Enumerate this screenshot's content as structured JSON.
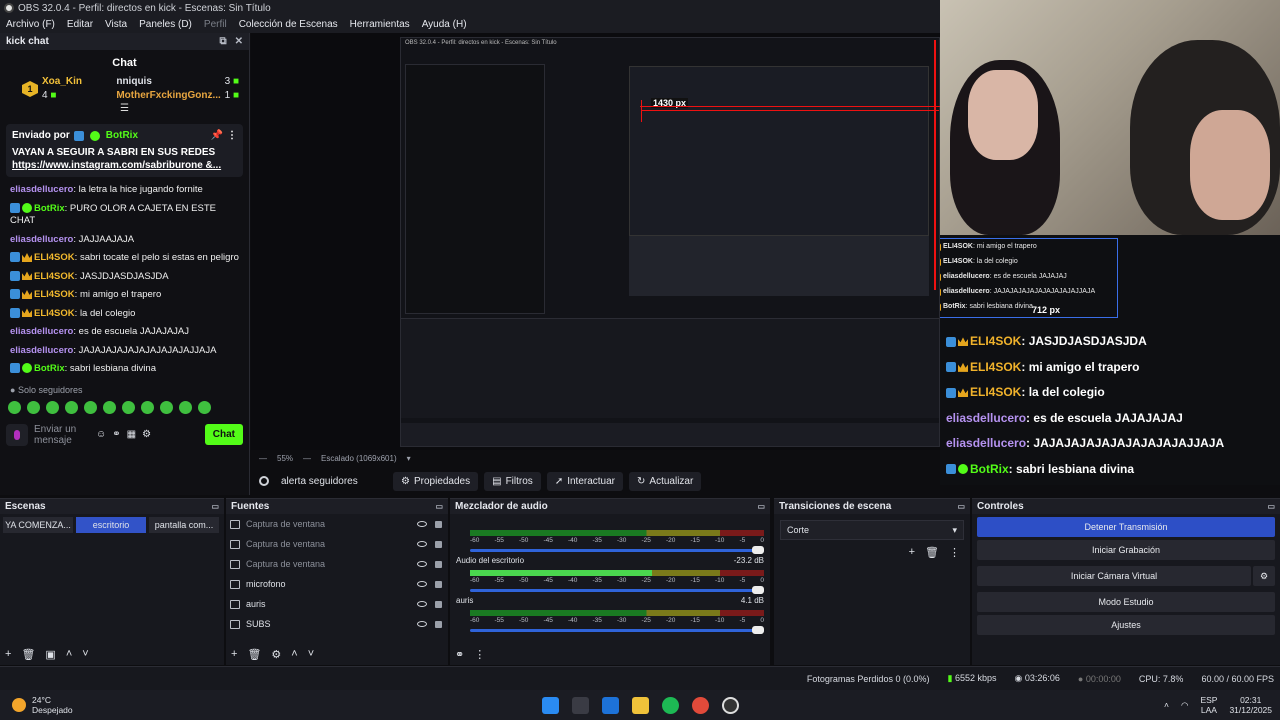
{
  "window": {
    "title": "OBS 32.0.4 - Perfil: directos en kick - Escenas: Sin Título"
  },
  "menu": [
    {
      "label": "Archivo (F)"
    },
    {
      "label": "Editar"
    },
    {
      "label": "Vista"
    },
    {
      "label": "Paneles (D)"
    },
    {
      "label": "Perfil"
    },
    {
      "label": "Colección de Escenas"
    },
    {
      "label": "Herramientas"
    },
    {
      "label": "Ayuda (H)"
    }
  ],
  "chat_dock": {
    "dock_title": "kick chat",
    "title": "Chat",
    "top": [
      {
        "rank": "1",
        "name": "Xoa_Kin",
        "count": "4"
      },
      {
        "name": "nniquis",
        "count": "3"
      },
      {
        "name": "MotherFxckingGonz...",
        "count": "1"
      }
    ],
    "pinned": {
      "header": "Enviado por",
      "user": "BotRix",
      "message": "VAYAN A SEGUIR A SABRI EN SUS REDES",
      "link": "https://www.instagram.com/sabriburone &..."
    },
    "messages": [
      {
        "user": "eliasdellucero",
        "text": "la letra la hice jugando fornite",
        "style": "blue",
        "badges": ""
      },
      {
        "user": "BotRix",
        "text": "PURO OLOR A CAJETA EN ESTE CHAT",
        "style": "green",
        "badges": "bot"
      },
      {
        "user": "eliasdellucero",
        "text": "JAJJAAJAJA",
        "style": "blue",
        "badges": ""
      },
      {
        "user": "ELI4SOK",
        "text": "sabri tocate el pelo si estas en peligro",
        "style": "gold",
        "badges": "crown"
      },
      {
        "user": "ELI4SOK",
        "text": "JASJDJASDJASJDA",
        "style": "gold",
        "badges": "crown"
      },
      {
        "user": "ELI4SOK",
        "text": "mi amigo el trapero",
        "style": "gold",
        "badges": "crown"
      },
      {
        "user": "ELI4SOK",
        "text": "la del colegio",
        "style": "gold",
        "badges": "crown"
      },
      {
        "user": "eliasdellucero",
        "text": "es de escuela JAJAJAJAJ",
        "style": "blue",
        "badges": ""
      },
      {
        "user": "eliasdellucero",
        "text": "JAJAJAJAJAJAJAJAJAJAJJAJA",
        "style": "blue",
        "badges": ""
      },
      {
        "user": "BotRix",
        "text": "sabri lesbiana divina",
        "style": "green",
        "badges": "bot"
      }
    ],
    "followers_only": "Solo seguidores",
    "input_placeholder": "Enviar un mensaje",
    "send_label": "Chat"
  },
  "preview": {
    "zoom": "55%",
    "scale": "Escalado (1069x601)",
    "width_label_1": "1430 px",
    "width_label_2": "712 px",
    "overlay_big": [
      {
        "user": "ELI4SOK",
        "text": "JASJDJASDJASJDA",
        "style": "gold"
      },
      {
        "user": "ELI4SOK",
        "text": "mi amigo el trapero",
        "style": "gold"
      },
      {
        "user": "ELI4SOK",
        "text": "la del colegio",
        "style": "gold"
      },
      {
        "user": "eliasdellucero",
        "text": "es de escuela JAJAJAJAJ",
        "style": "blue"
      },
      {
        "user": "eliasdellucero",
        "text": "JAJAJAJAJAJAJAJAJAJAJJAJA",
        "style": "blue"
      },
      {
        "user": "BotRix",
        "text": "sabri lesbiana divina",
        "style": "green"
      }
    ],
    "overlay_small": [
      {
        "user": "ELI4SOK",
        "text": "mi amigo el trapero"
      },
      {
        "user": "ELI4SOK",
        "text": "la del colegio"
      },
      {
        "user": "eliasdellucero",
        "text": "es de escuela JAJAJAJ"
      },
      {
        "user": "eliasdellucero",
        "text": "JAJAJAJAJAJAJAJAJAJAJJAJA"
      },
      {
        "user": "BotRix",
        "text": "sabri lesbiana divina"
      }
    ]
  },
  "source_bar": {
    "selected": "alerta seguidores",
    "buttons": [
      "Propiedades",
      "Filtros",
      "Interactuar",
      "Actualizar"
    ]
  },
  "docks": {
    "scenes": {
      "title": "Escenas",
      "items": [
        "YA COMENZA...",
        "escritorio",
        "pantalla com..."
      ],
      "selected": "escritorio"
    },
    "sources": {
      "title": "Fuentes",
      "items": [
        {
          "name": "Captura de ventana",
          "visible": false
        },
        {
          "name": "Captura de ventana",
          "visible": false
        },
        {
          "name": "Captura de ventana",
          "visible": false
        },
        {
          "name": "microfono",
          "visible": true
        },
        {
          "name": "auris",
          "visible": true
        },
        {
          "name": "SUBS",
          "visible": true
        }
      ]
    },
    "mixer": {
      "title": "Mezclador de audio",
      "channels": [
        {
          "name": "",
          "db": "",
          "level": 0.0
        },
        {
          "name": "Audio del escritorio",
          "db": "-23.2 dB",
          "level": 0.62
        },
        {
          "name": "auris",
          "db": "4.1 dB",
          "level": 0.0
        }
      ],
      "scale": [
        "-60",
        "-55",
        "-50",
        "-45",
        "-40",
        "-35",
        "-30",
        "-25",
        "-20",
        "-15",
        "-10",
        "-5",
        "0"
      ]
    },
    "transitions": {
      "title": "Transiciones de escena",
      "value": "Corte"
    },
    "controls": {
      "title": "Controles",
      "buttons": [
        "Detener Transmisión",
        "Iniciar Grabación",
        "Iniciar Cámara Virtual",
        "Modo Estudio",
        "Ajustes"
      ]
    }
  },
  "status": {
    "dropped": "Fotogramas Perdidos 0 (0.0%)",
    "bitrate": "6552 kbps",
    "stream_time": "03:26:06",
    "rec_time": "00:00:00",
    "cpu": "CPU: 7.8%",
    "fps": "60.00 / 60.00 FPS"
  },
  "taskbar": {
    "temp": "24°C",
    "weather": "Despejado",
    "lang": "ESP",
    "layout": "LAA",
    "time": "02:31",
    "date": "31/12/2025"
  }
}
